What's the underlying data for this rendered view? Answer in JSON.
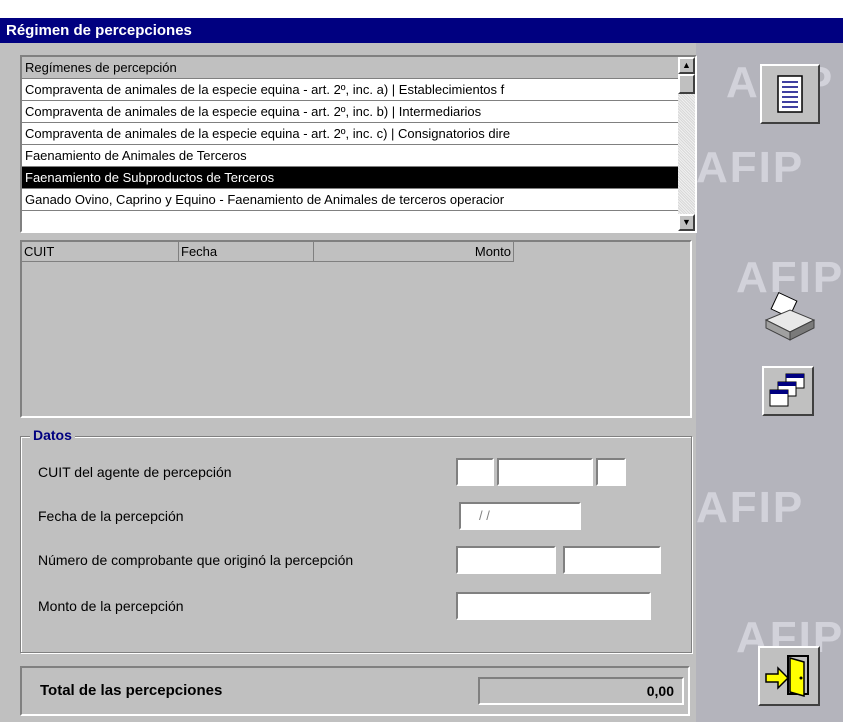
{
  "window": {
    "title": "Régimen de percepciones"
  },
  "list": {
    "header": "Regímenes de percepción",
    "items": [
      "Compraventa de animales de la especie equina - art. 2º, inc. a) | Establecimientos f",
      "Compraventa de animales de la especie equina - art. 2º, inc. b) | Intermediarios",
      "Compraventa de animales de la especie equina - art. 2º, inc. c) | Consignatorios dire",
      "Faenamiento de Animales de Terceros",
      "Faenamiento de Subproductos de Terceros",
      "Ganado Ovino, Caprino y Equino - Faenamiento de Animales de terceros operacior"
    ],
    "selected_index": 4
  },
  "grid": {
    "columns": [
      "CUIT",
      "Fecha",
      "Monto"
    ]
  },
  "datos": {
    "legend": "Datos",
    "cuit_label": "CUIT del agente de percepción",
    "fecha_label": "Fecha de la percepción",
    "fecha_mask": "/   /",
    "comprobante_label": "Número de comprobante que originó la percepción",
    "monto_label": "Monto de la percepción"
  },
  "total": {
    "label": "Total de las percepciones",
    "value": "0,00"
  },
  "watermark": [
    "AFIP",
    "AFIP",
    "AFIP",
    "AFIP",
    "AFIP"
  ],
  "icons": [
    "list-icon",
    "printer-icon",
    "windows-icon",
    "exit-door-icon"
  ]
}
